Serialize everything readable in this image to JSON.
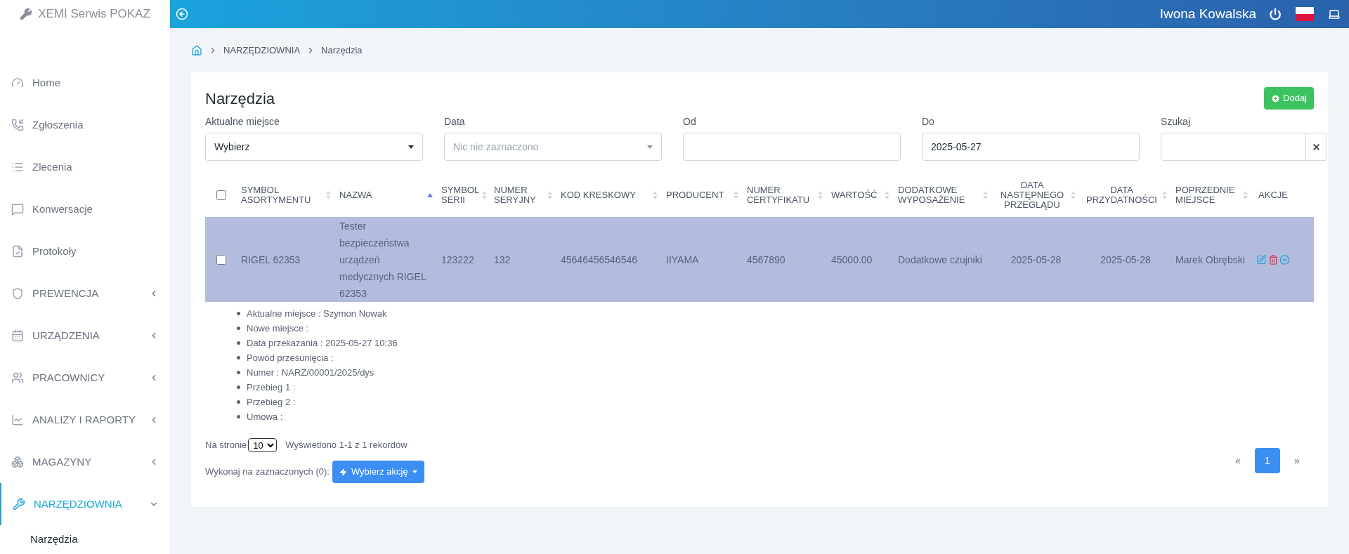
{
  "sidebar": {
    "brand": "XEMI Serwis POKAZ",
    "items": [
      {
        "label": "Home",
        "kind": "link",
        "selected": false
      },
      {
        "label": "Zgłoszenia",
        "kind": "link",
        "selected": false
      },
      {
        "label": "Zlecenia",
        "kind": "link",
        "selected": false
      },
      {
        "label": "Konwersacje",
        "kind": "link",
        "selected": false
      },
      {
        "label": "Protokoły",
        "kind": "link",
        "selected": false
      },
      {
        "label": "PREWENCJA",
        "kind": "group",
        "selected": false,
        "expanded": false
      },
      {
        "label": "URZĄDZENIA",
        "kind": "group",
        "selected": false,
        "expanded": false
      },
      {
        "label": "PRACOWNICY",
        "kind": "group",
        "selected": false,
        "expanded": false
      },
      {
        "label": "ANALIZY I RAPORTY",
        "kind": "group",
        "selected": false,
        "expanded": false
      },
      {
        "label": "MAGAZYNY",
        "kind": "group",
        "selected": false,
        "expanded": false
      },
      {
        "label": "NARZĘDZIOWNIA",
        "kind": "group",
        "selected": true,
        "expanded": true,
        "children": [
          {
            "label": "Narzędzia",
            "selected": true
          }
        ]
      }
    ]
  },
  "header": {
    "user": "Iwona Kowalska"
  },
  "breadcrumb": [
    "NARZĘDZIOWNIA",
    "Narzędzia"
  ],
  "page": {
    "title": "Narzędzia",
    "add_button": "Dodaj"
  },
  "filters": [
    {
      "label": "Aktualne miejsce",
      "kind": "select",
      "value": "Wybierz"
    },
    {
      "label": "Data",
      "kind": "select",
      "placeholder": "Nic nie zaznaczono"
    },
    {
      "label": "Od",
      "kind": "input"
    },
    {
      "label": "Do",
      "kind": "input",
      "value": "2025-05-27"
    },
    {
      "label": "Szukaj",
      "kind": "search"
    }
  ],
  "table": {
    "select_all_checked": false,
    "columns": [
      {
        "label": "SYMBOL ASORTYMENTU",
        "sortable": true,
        "sorted": false
      },
      {
        "label": "NAZWA",
        "sortable": true,
        "sorted": true
      },
      {
        "label": "SYMBOL SERII",
        "sortable": true,
        "sorted": false
      },
      {
        "label": "NUMER SERYJNY",
        "sortable": true,
        "sorted": false
      },
      {
        "label": "KOD KRESKOWY",
        "sortable": true,
        "sorted": false
      },
      {
        "label": "PRODUCENT",
        "sortable": true,
        "sorted": false
      },
      {
        "label": "NUMER CERTYFIKATU",
        "sortable": true,
        "sorted": false
      },
      {
        "label": "WARTOŚĆ",
        "sortable": true,
        "sorted": false
      },
      {
        "label": "DODATKOWE WYPOSAŻENIE",
        "sortable": true,
        "sorted": false
      },
      {
        "label": "DATA NASTĘPNEGO PRZEGLĄDU",
        "sortable": true,
        "sorted": false
      },
      {
        "label": "DATA PRZYDATNOŚCI",
        "sortable": true,
        "sorted": false
      },
      {
        "label": "POPRZEDNIE MIEJSCE",
        "sortable": true,
        "sorted": false
      },
      {
        "label": "AKCJE",
        "sortable": false
      }
    ],
    "rows": [
      {
        "checked": false,
        "selected": true,
        "cells": [
          "RIGEL 62353",
          "Tester bezpieczeństwa urządzeń medycznych RIGEL 62353",
          "123222",
          "132",
          "45646456546546",
          "IIYAMA",
          "4567890",
          "45000.00",
          "Dodatkowe czujniki",
          "2025-05-28",
          "2025-05-28",
          "Marek Obrębski"
        ],
        "details": [
          "Aktualne miejsce : Szymon Nowak",
          "Nowe miejsce :",
          "Data przekazania : 2025-05-27 10:36",
          "Powód przesunięcia :",
          "Numer : NARZ/00001/2025/dys",
          "Przebieg 1 :",
          "Przebieg 2 :",
          "Umowa :"
        ]
      }
    ]
  },
  "footer": {
    "per_page_label": "Na stronie",
    "per_page": "10",
    "summary": "Wyświetlono 1-1 z 1 rekordów",
    "bulk_label": "Wykonaj na zaznaczonych (0):",
    "bulk_button": "Wybierz akcję",
    "pagination": [
      {
        "label": "«",
        "selected": false
      },
      {
        "label": "1",
        "selected": true
      },
      {
        "label": "»",
        "selected": false
      }
    ]
  }
}
